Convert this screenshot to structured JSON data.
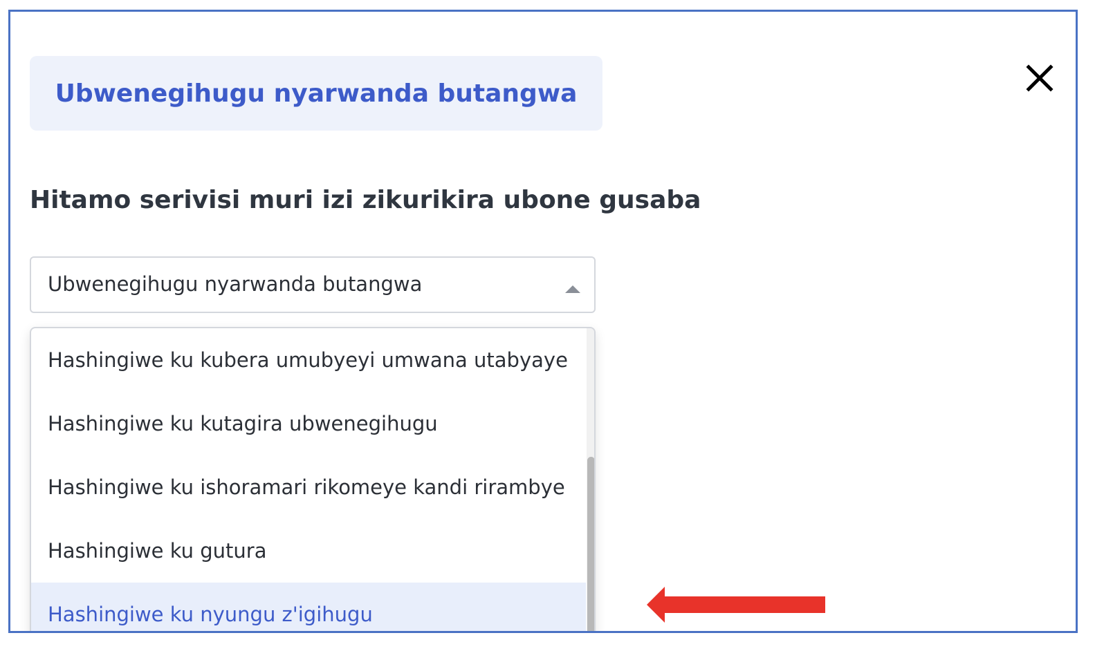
{
  "dialog": {
    "title": "Ubwenegihugu nyarwanda butangwa",
    "close_icon": "close-icon"
  },
  "heading": "Hitamo serivisi muri izi zikurikira ubone gusaba",
  "select": {
    "value": "Ubwenegihugu nyarwanda butangwa",
    "caret_icon": "caret-up-icon"
  },
  "dropdown": {
    "options": [
      {
        "label": "Hashingiwe ku kubera umubyeyi umwana utabyaye"
      },
      {
        "label": "Hashingiwe ku kutagira ubwenegihugu"
      },
      {
        "label": "Hashingiwe ku ishoramari rikomeye kandi rirambye"
      },
      {
        "label": "Hashingiwe ku gutura"
      },
      {
        "label": "Hashingiwe ku nyungu z'igihugu"
      }
    ],
    "highlighted_index": 4
  },
  "annotation": {
    "arrow_icon": "red-arrow-left-icon",
    "arrow_color": "#e8332a"
  },
  "colors": {
    "accent": "#3d5bc9",
    "frame": "#4a72c4",
    "pill_bg": "#eef2fb",
    "highlight_bg": "#e8eefb"
  }
}
